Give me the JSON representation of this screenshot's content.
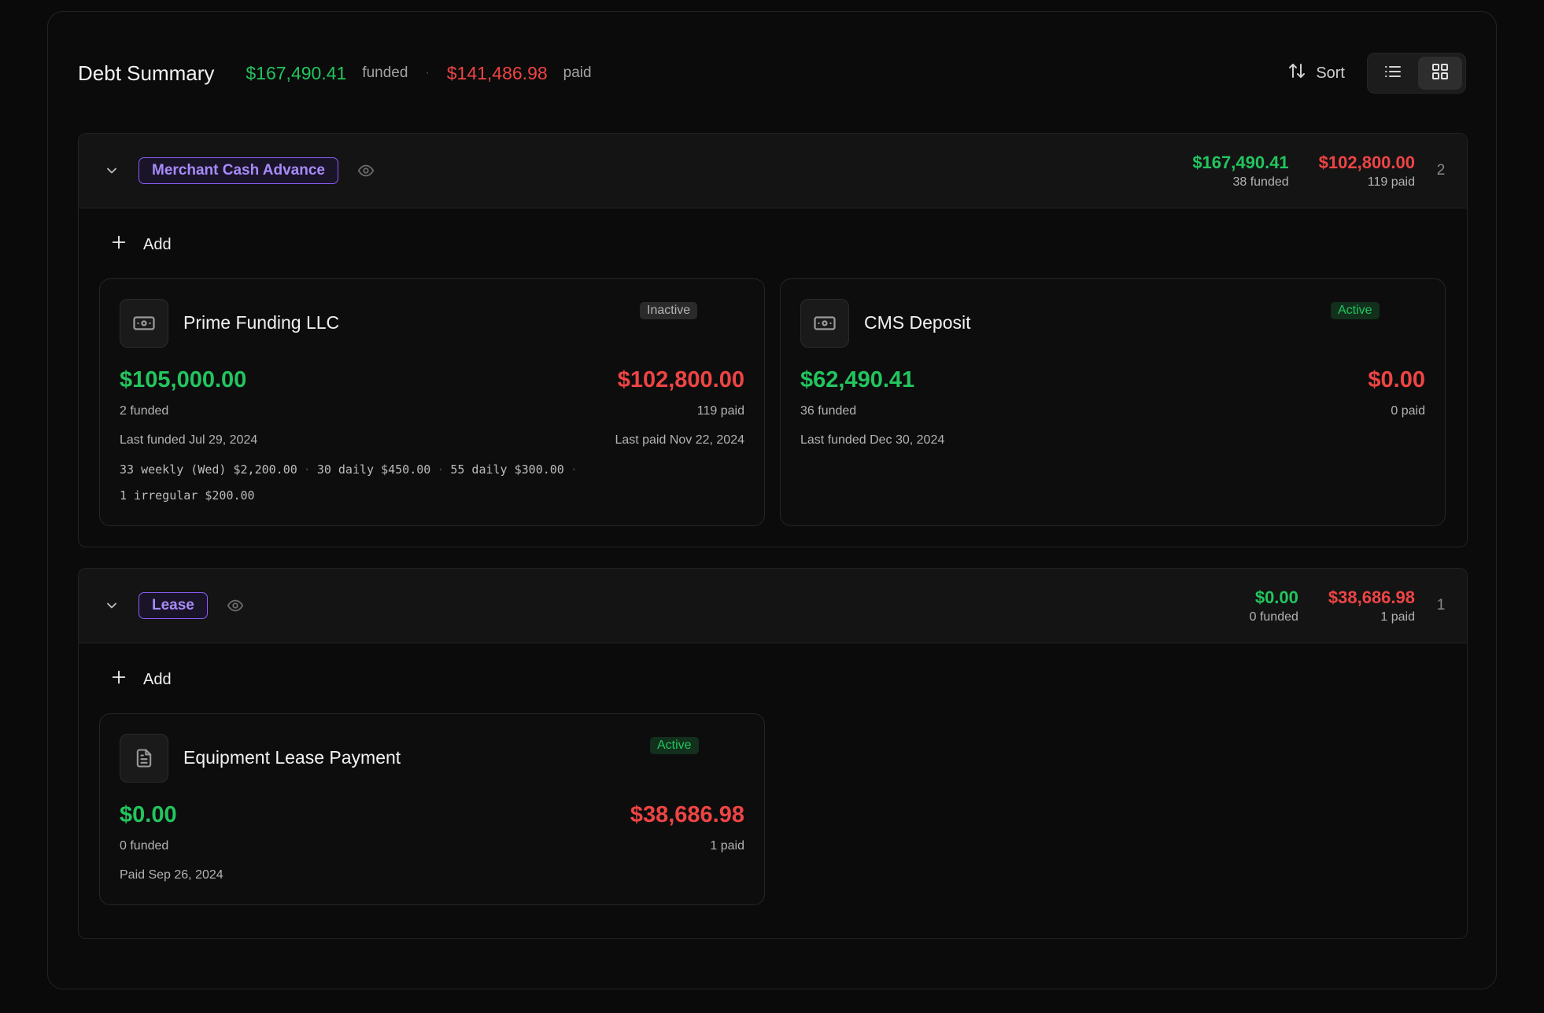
{
  "header": {
    "title": "Debt Summary",
    "total_funded": "$167,490.41",
    "funded_label": "funded",
    "separator": "·",
    "total_paid": "$141,486.98",
    "paid_label": "paid",
    "sort_label": "Sort",
    "view_mode": "grid"
  },
  "groups": [
    {
      "tag": "Merchant Cash Advance",
      "funded": "$167,490.41",
      "funded_label": "38 funded",
      "paid": "$102,800.00",
      "paid_label": "119 paid",
      "count": "2",
      "add_label": "Add",
      "cards": [
        {
          "name": "Prime Funding LLC",
          "icon": "banknote-icon",
          "status": "Inactive",
          "funded": "$105,000.00",
          "funded_label": "2 funded",
          "paid": "$102,800.00",
          "paid_label": "119 paid",
          "last_funded": "Last funded Jul 29, 2024",
          "last_paid": "Last paid Nov 22, 2024",
          "schedule": [
            "33 weekly (Wed) $2,200.00",
            "30 daily $450.00",
            "55 daily $300.00",
            "1 irregular $200.00"
          ]
        },
        {
          "name": "CMS Deposit",
          "icon": "banknote-icon",
          "status": "Active",
          "funded": "$62,490.41",
          "funded_label": "36 funded",
          "paid": "$0.00",
          "paid_label": "0 paid",
          "last_funded": "Last funded Dec 30, 2024"
        }
      ]
    },
    {
      "tag": "Lease",
      "funded": "$0.00",
      "funded_label": "0 funded",
      "paid": "$38,686.98",
      "paid_label": "1 paid",
      "count": "1",
      "add_label": "Add",
      "cards": [
        {
          "name": "Equipment Lease Payment",
          "icon": "document-icon",
          "status": "Active",
          "funded": "$0.00",
          "funded_label": "0 funded",
          "paid": "$38,686.98",
          "paid_label": "1 paid",
          "last_paid": "Paid Sep 26, 2024"
        }
      ]
    }
  ],
  "colors": {
    "funded": "#22c55e",
    "paid": "#ef4444",
    "tag": "#8b5cf6",
    "background": "#0a0a0a"
  }
}
